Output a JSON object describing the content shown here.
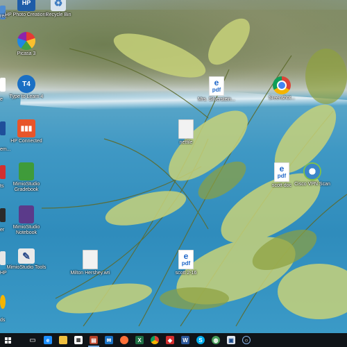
{
  "desktop_icons": [
    {
      "name": "hp-photo-creations-icon",
      "label": "HP Photo Creations",
      "icon": "hp-photo-icon"
    },
    {
      "name": "recycle-bin-icon",
      "label": "Recycle Bin",
      "icon": "recycle-bin-icon"
    },
    {
      "name": "picasa-icon",
      "label": "Picasa 3",
      "icon": "picasa-icon"
    },
    {
      "name": "typing-to-learn-icon",
      "label": "Type to Learn 4",
      "icon": "typing-icon"
    },
    {
      "name": "hp-connected-icon",
      "label": "HP Connected",
      "icon": "hp-connected-icon"
    },
    {
      "name": "mimio-gradebook-icon",
      "label": "MimioStudio Gradebook",
      "icon": "green-book-icon"
    },
    {
      "name": "mimio-notebook-icon",
      "label": "MimioStudio Notebook",
      "icon": "purple-book-icon"
    },
    {
      "name": "mimio-tools-icon",
      "label": "MimioStudio Tools",
      "icon": "tools-icon"
    },
    {
      "name": "mrs-silverstein-pdf-icon",
      "label": "Mrs. Silverstein...",
      "icon": "pdf-icon"
    },
    {
      "name": "sreenshot-icon",
      "label": "Sreenshot...",
      "icon": "chrome-icon"
    },
    {
      "name": "netfile-icon",
      "label": "netfile",
      "icon": "document-icon"
    },
    {
      "name": "scott-doc-pdf-icon",
      "label": "scott doc",
      "icon": "pdf-icon"
    },
    {
      "name": "cisco-vpn-icon",
      "label": "Cisco VPN Scan",
      "icon": "cisco-icon"
    },
    {
      "name": "milton-hershey-icon",
      "label": "Milton Hershey.wri",
      "icon": "document-icon"
    },
    {
      "name": "scott-2-16-pdf-icon",
      "label": "scott 2-16",
      "icon": "pdf-icon"
    }
  ],
  "left_edge_labels": [
    "ree",
    "e",
    "e to",
    "em...",
    "ts",
    "er",
    "HP",
    "ds"
  ],
  "taskbar": {
    "items": [
      {
        "name": "task-view-icon",
        "glyph": "▭"
      },
      {
        "name": "edge-browser-icon",
        "glyph": "e"
      },
      {
        "name": "file-explorer-icon",
        "glyph": "▇"
      },
      {
        "name": "store-icon",
        "glyph": "▦"
      },
      {
        "name": "photo-app-icon",
        "glyph": "▤"
      },
      {
        "name": "mail-icon",
        "glyph": "✉"
      },
      {
        "name": "firefox-icon",
        "glyph": "●"
      },
      {
        "name": "excel-icon",
        "glyph": "X"
      },
      {
        "name": "chrome-taskbar-icon",
        "glyph": "◉"
      },
      {
        "name": "app-red-icon",
        "glyph": "◆"
      },
      {
        "name": "word-icon",
        "glyph": "W"
      },
      {
        "name": "skype-icon",
        "glyph": "S"
      },
      {
        "name": "app-globe-icon",
        "glyph": "◍"
      },
      {
        "name": "app-monitor-icon",
        "glyph": "▣"
      },
      {
        "name": "cortana-icon",
        "glyph": "○"
      }
    ],
    "colors": {
      "edge": "#1e90ff",
      "explorer": "#f0c040",
      "excel": "#1e7145",
      "word": "#2b579a",
      "skype": "#00aff0",
      "firefox": "#ff7139",
      "red": "#d32f2f"
    }
  }
}
